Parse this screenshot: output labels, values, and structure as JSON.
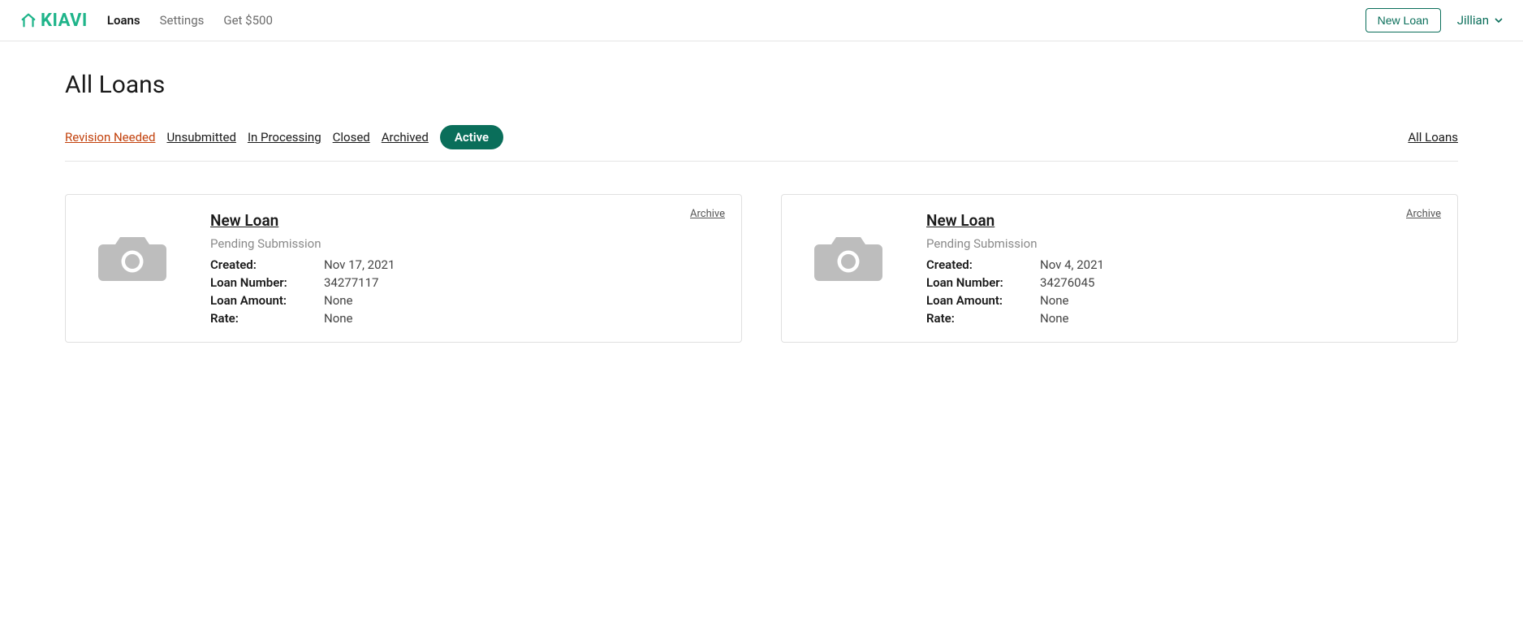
{
  "header": {
    "logo_text": "KIAVI",
    "nav": [
      {
        "label": "Loans",
        "active": true
      },
      {
        "label": "Settings",
        "active": false
      },
      {
        "label": "Get $500",
        "active": false
      }
    ],
    "new_loan_label": "New Loan",
    "user_name": "Jillian"
  },
  "page": {
    "title": "All Loans",
    "filters": [
      {
        "label": "Revision Needed",
        "kind": "revision"
      },
      {
        "label": "Unsubmitted",
        "kind": "link"
      },
      {
        "label": "In Processing",
        "kind": "link"
      },
      {
        "label": "Closed",
        "kind": "link"
      },
      {
        "label": "Archived",
        "kind": "link"
      },
      {
        "label": "Active",
        "kind": "pill"
      }
    ],
    "all_loans_label": "All Loans"
  },
  "loan_field_labels": {
    "created": "Created:",
    "loan_number": "Loan Number:",
    "loan_amount": "Loan Amount:",
    "rate": "Rate:"
  },
  "archive_label": "Archive",
  "loans": [
    {
      "title": "New Loan",
      "status": "Pending Submission",
      "created": "Nov 17, 2021",
      "loan_number": "34277117",
      "loan_amount": "None",
      "rate": "None"
    },
    {
      "title": "New Loan",
      "status": "Pending Submission",
      "created": "Nov 4, 2021",
      "loan_number": "34276045",
      "loan_amount": "None",
      "rate": "None"
    }
  ]
}
